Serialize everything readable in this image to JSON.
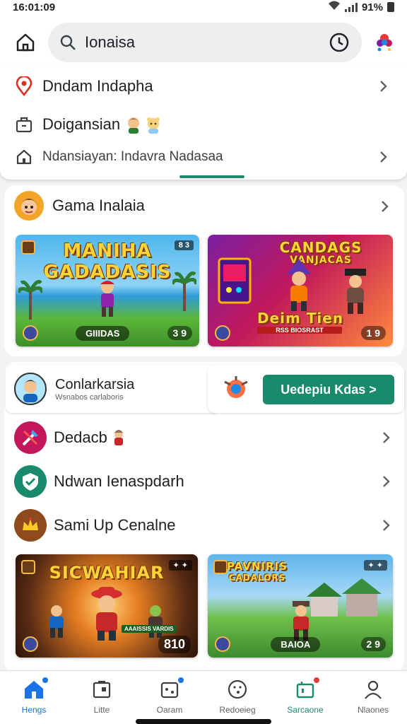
{
  "status": {
    "time": "16:01:09",
    "battery": "91%"
  },
  "search": {
    "query": "Ionaisa"
  },
  "suggestions": [
    {
      "label": "Dndam Indapha",
      "icon": "location-pin-icon"
    },
    {
      "label": "Doigansian",
      "icon": "briefcase-icon"
    },
    {
      "label": "Ndansiayan: Indavra  Nadasaa",
      "icon": "home-outline-icon"
    }
  ],
  "games_section": {
    "title": "Gama Inalaia",
    "tiles": [
      {
        "title_line1": "MANIHA",
        "title_line2": "GADADASIS",
        "tag": "8 3",
        "pill": "GIIIDAS",
        "score": "3 9"
      },
      {
        "title_line1": "CANDAGS",
        "title_line2": "VANJACAS",
        "subtitle": "Deim Tien",
        "caption": "RSS BIOSRAST",
        "tag": "",
        "score": "1 9"
      }
    ]
  },
  "promo": {
    "title": "Conlarkarsia",
    "subtitle": "Wsnabos carlaboris",
    "cta": "Uedepiu Kdas >"
  },
  "list": [
    {
      "label": "Dedacb",
      "color": "#c2185b"
    },
    {
      "label": "Ndwan Ienaspdarh",
      "color": "#1a8a6c"
    },
    {
      "label": "Sami Up Cenalne",
      "color": "#8e4a1c"
    }
  ],
  "bottom_tiles": [
    {
      "title": "SICWAHIAR",
      "caption": "AAAISSIS VARDIS",
      "score": "810"
    },
    {
      "title_line1": "PAVNIRIS",
      "title_line2": "CADALORS",
      "pill": "BAIOA",
      "score": "2 9"
    }
  ],
  "nav": [
    {
      "label": "Hengs",
      "active": true
    },
    {
      "label": "Litte"
    },
    {
      "label": "Oaram"
    },
    {
      "label": "Redoeieg"
    },
    {
      "label": "Sarcaone",
      "green": true
    },
    {
      "label": "Nlaones"
    }
  ],
  "colors": {
    "accent": "#1a8a6c",
    "blue": "#1a73e8",
    "red_badge": "#e53935"
  }
}
